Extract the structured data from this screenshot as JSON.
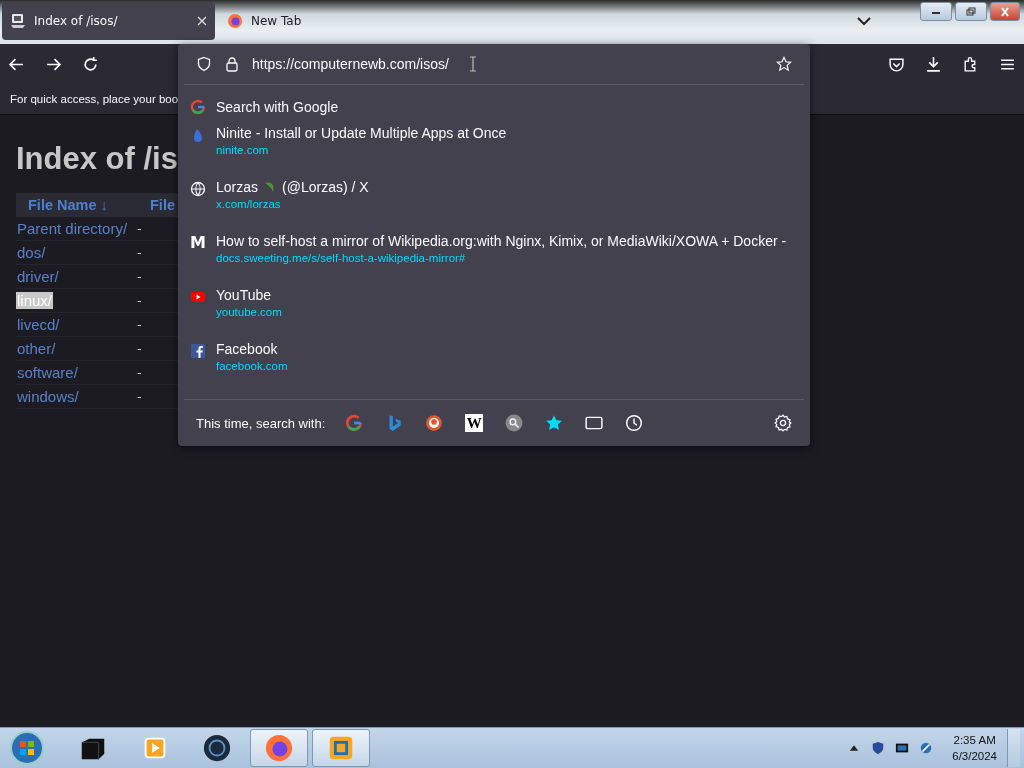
{
  "tabs": [
    {
      "title": "Index of /isos/",
      "selected": true,
      "kind": "computer"
    },
    {
      "title": "New Tab",
      "selected": false,
      "kind": "firefox"
    }
  ],
  "url_bar": {
    "value": "https://computernewb.com/isos/"
  },
  "bookmarks_hint": "For quick access, place your boo",
  "page": {
    "heading": "Index of /is",
    "columns": [
      {
        "label": "File Name",
        "sort": "↓"
      },
      {
        "label": "File"
      }
    ],
    "rows": [
      {
        "name": "Parent directory/",
        "size": "-",
        "selected": false
      },
      {
        "name": "dos/",
        "size": "-",
        "selected": false
      },
      {
        "name": "driver/",
        "size": "-",
        "selected": false
      },
      {
        "name": "linux/",
        "size": "-",
        "selected": true
      },
      {
        "name": "livecd/",
        "size": "-",
        "selected": false
      },
      {
        "name": "other/",
        "size": "-",
        "selected": false
      },
      {
        "name": "software/",
        "size": "-",
        "selected": false
      },
      {
        "name": "windows/",
        "size": "-",
        "selected": false
      }
    ]
  },
  "suggestions": [
    {
      "kind": "google",
      "title": "Search with Google"
    },
    {
      "kind": "ninite",
      "title": "Ninite - Install or Update Multiple Apps at Once",
      "url": "ninite.com"
    },
    {
      "kind": "globe",
      "title": "Lorzas",
      "title_after_icon": "(@Lorzas) / X",
      "url": "x.com/lorzas"
    },
    {
      "kind": "letter",
      "glyph": "M",
      "title": "How to self-host a mirror of Wikipedia.org:with Nginx, Kimix, or MediaWiki/XOWA + Docker -",
      "url": "docs.sweeting.me/s/self-host-a-wikipedia-mirror#"
    },
    {
      "kind": "youtube",
      "title": "YouTube",
      "url": "youtube.com"
    },
    {
      "kind": "facebook",
      "title": "Facebook",
      "url": "facebook.com"
    }
  ],
  "search_with": {
    "label": "This time, search with:",
    "engines": [
      {
        "kind": "google"
      },
      {
        "kind": "bing"
      },
      {
        "kind": "duckduckgo"
      },
      {
        "kind": "wikipedia",
        "glyph": "W"
      },
      {
        "kind": "search"
      },
      {
        "kind": "bookmarks"
      },
      {
        "kind": "tabs"
      },
      {
        "kind": "history"
      }
    ]
  },
  "taskbar": {
    "items": [
      {
        "kind": "box",
        "active": false
      },
      {
        "kind": "player",
        "active": false
      },
      {
        "kind": "orb",
        "active": false
      },
      {
        "kind": "firefox",
        "active": true
      },
      {
        "kind": "vm",
        "active": true
      }
    ],
    "time": "2:35 AM",
    "date": "6/3/2024"
  }
}
